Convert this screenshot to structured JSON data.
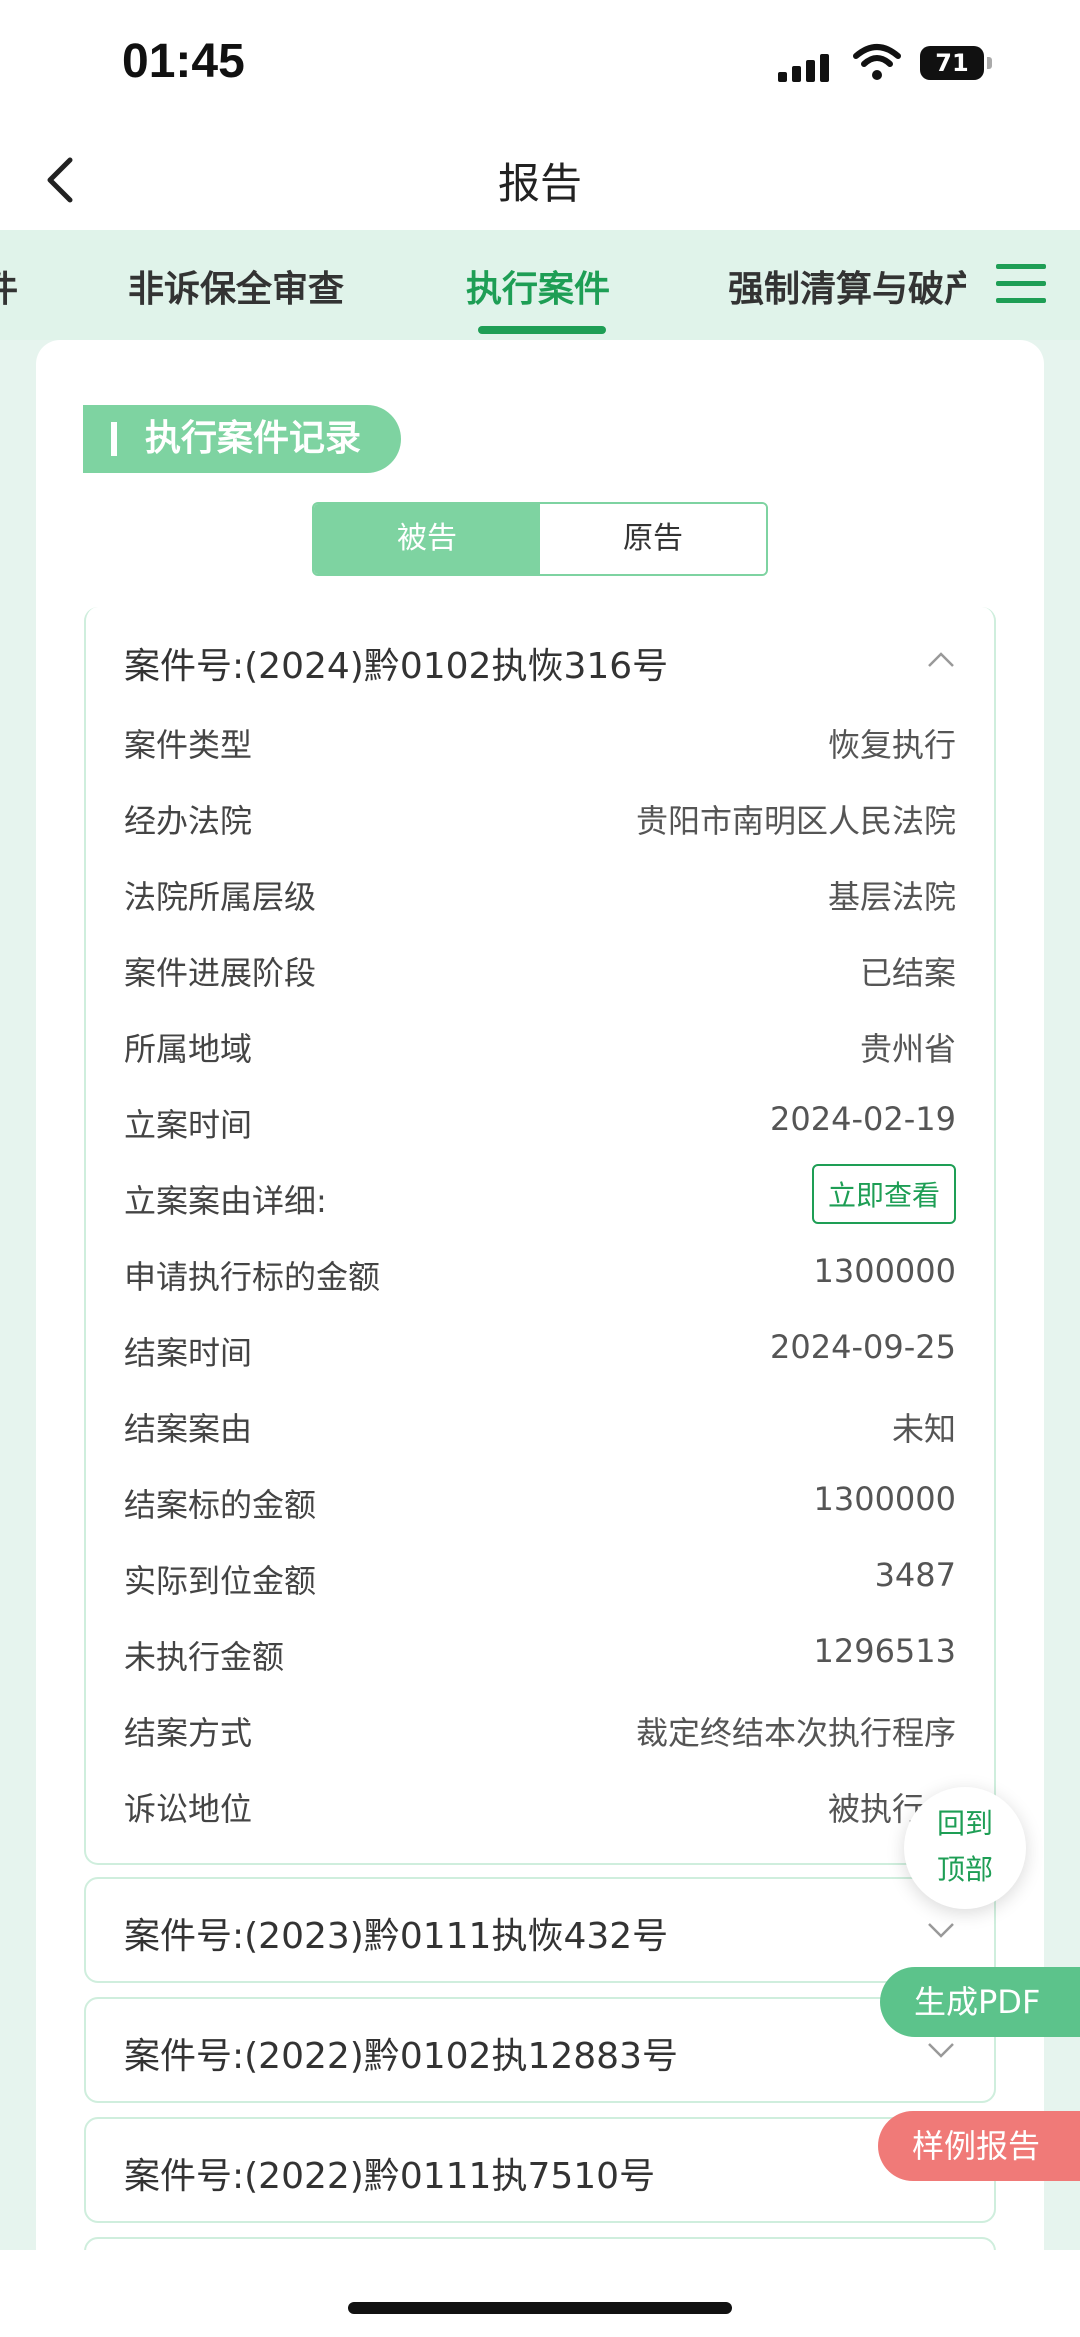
{
  "status": {
    "time": "01:45",
    "battery": "71"
  },
  "nav": {
    "title": "报告"
  },
  "tabs": [
    {
      "label": "件"
    },
    {
      "label": "非诉保全审查"
    },
    {
      "label": "执行案件"
    },
    {
      "label": "强制清算与破产"
    }
  ],
  "section": {
    "title": "执行案件记录"
  },
  "segment": {
    "defendant": "被告",
    "plaintiff": "原告"
  },
  "case1": {
    "title": "案件号:(2024)黔0102执恢316号",
    "rows": [
      {
        "k": "案件类型",
        "v": "恢复执行"
      },
      {
        "k": "经办法院",
        "v": "贵阳市南明区人民法院"
      },
      {
        "k": "法院所属层级",
        "v": "基层法院"
      },
      {
        "k": "案件进展阶段",
        "v": "已结案"
      },
      {
        "k": "所属地域",
        "v": "贵州省"
      },
      {
        "k": "立案时间",
        "v": "2024-02-19"
      },
      {
        "k": "立案案由详细:",
        "btn": "立即查看"
      },
      {
        "k": "申请执行标的金额",
        "v": "1300000"
      },
      {
        "k": "结案时间",
        "v": "2024-09-25"
      },
      {
        "k": "结案案由",
        "v": "未知"
      },
      {
        "k": "结案标的金额",
        "v": "1300000"
      },
      {
        "k": "实际到位金额",
        "v": "3487"
      },
      {
        "k": "未执行金额",
        "v": "1296513"
      },
      {
        "k": "结案方式",
        "v": "裁定终结本次执行程序"
      },
      {
        "k": "诉讼地位",
        "v": "被执行人"
      }
    ]
  },
  "case2": {
    "title": "案件号:(2023)黔0111执恢432号"
  },
  "case3": {
    "title": "案件号:(2022)黔0102执12883号"
  },
  "case4": {
    "title": "案件号:(2022)黔0111执7510号"
  },
  "floats": {
    "top_line1": "回到",
    "top_line2": "顶部",
    "pdf": "生成PDF",
    "sample": "样例报告"
  }
}
